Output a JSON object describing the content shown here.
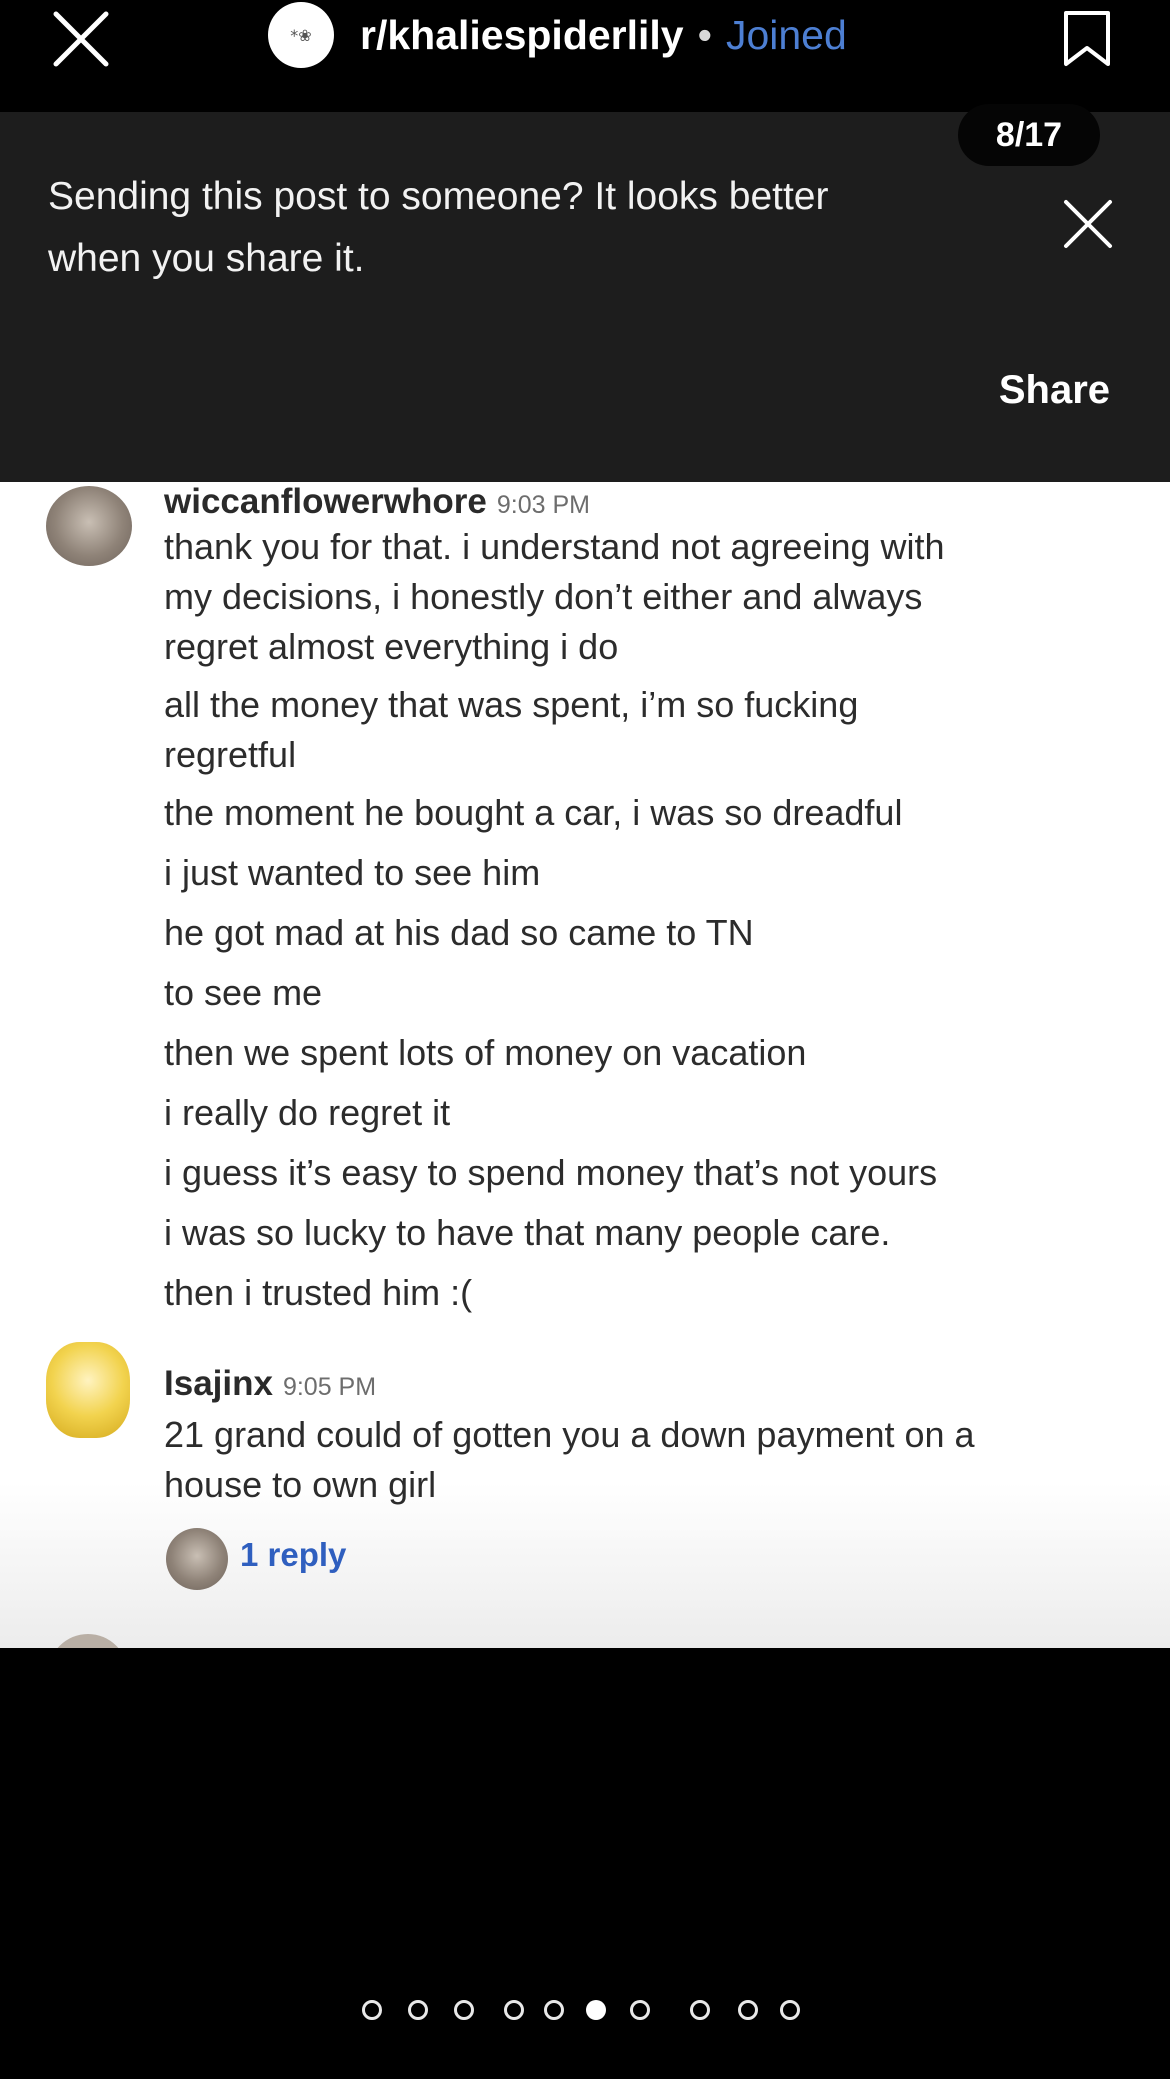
{
  "header": {
    "subreddit": "r/khaliespiderlily",
    "separator": "•",
    "joined_label": "Joined",
    "avatar_glyphs": "*❀"
  },
  "banner": {
    "counter": "8/17",
    "message": "Sending this post to someone? It looks better when you share it.",
    "share_label": "Share"
  },
  "comments": [
    {
      "user": "wiccanflowerwhore",
      "time": "9:03 PM",
      "lines": [
        "thank you for that. i understand not agreeing with",
        "my decisions, i honestly don’t either and always",
        "regret almost everything i do",
        "all the money that was spent, i’m so fucking",
        "regretful",
        "the moment he bought a car, i was so dreadful",
        "i just wanted to see him",
        "he got mad at his dad so came to TN",
        "to see me",
        "then we spent lots of money on vacation",
        "i really do regret it",
        "i guess it’s easy to spend money that’s not yours",
        "i was so lucky to have that many people care.",
        "then i trusted him :("
      ]
    },
    {
      "user": "Isajinx",
      "time": "9:05 PM",
      "lines": [
        "21 grand could of gotten you a down payment on a",
        "house to own girl"
      ]
    }
  ],
  "reply_link": "1 reply",
  "colors": {
    "joined": "#4d7fd3",
    "reply_link": "#2f5fbf",
    "banner_bg": "#1d1d1d"
  },
  "pagination": {
    "total_dots": 17,
    "active_index": 8
  }
}
